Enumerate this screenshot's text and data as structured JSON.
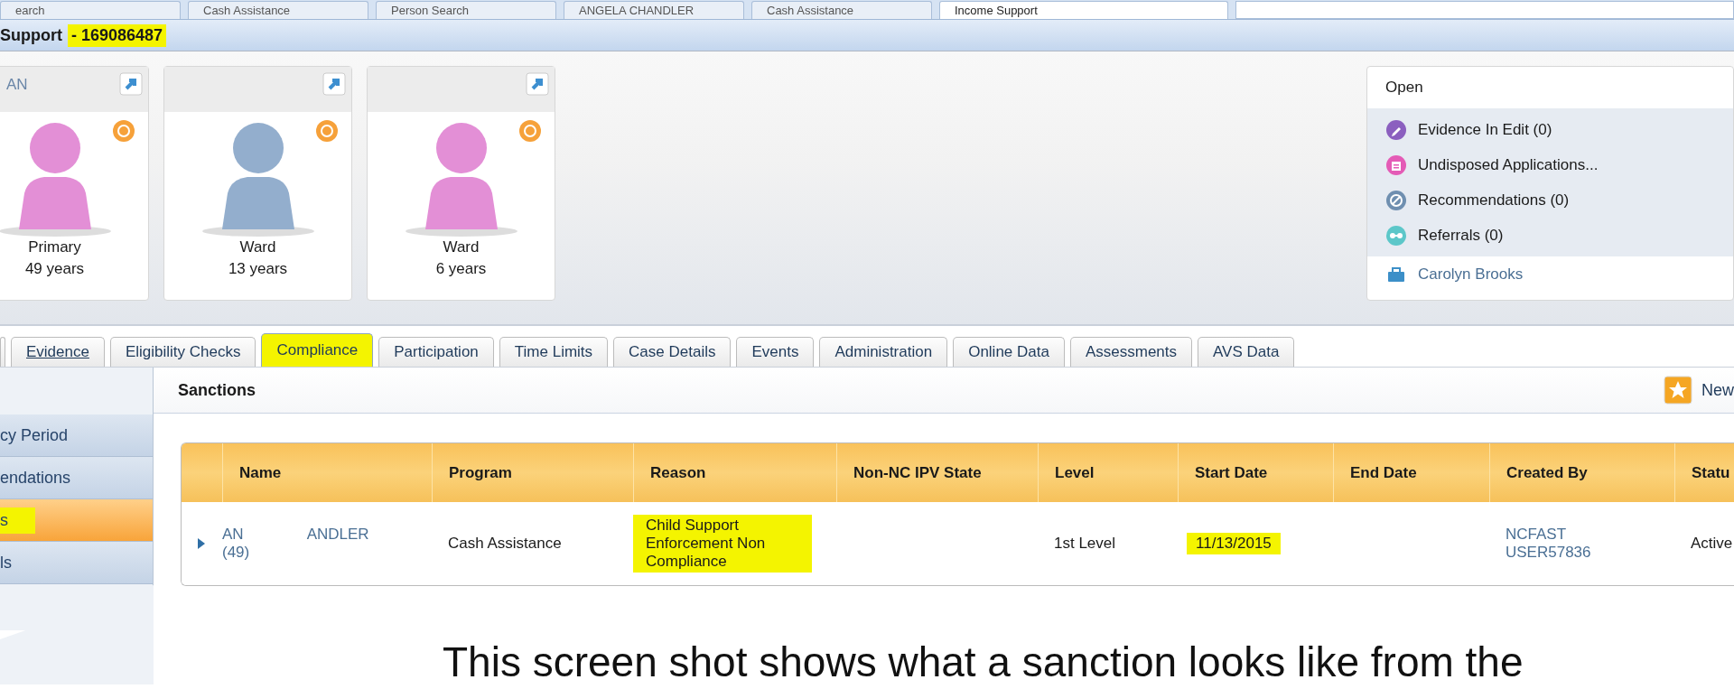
{
  "window_tabs": [
    {
      "label": "earch",
      "selected": false
    },
    {
      "label": "Cash Assistance",
      "selected": false
    },
    {
      "label": "Person Search",
      "selected": false
    },
    {
      "label": "ANGELA CHANDLER",
      "selected": false
    },
    {
      "label": "Cash Assistance",
      "selected": false
    },
    {
      "label": "Income Support",
      "selected": true
    }
  ],
  "title": {
    "text": "Support",
    "number": "- 169086487",
    "highlighted": true
  },
  "people": [
    {
      "name": "AN",
      "role": "Primary",
      "age": "49 years",
      "color": "#e38fd6"
    },
    {
      "role": "Ward",
      "age": "13 years",
      "color": "#93aecd"
    },
    {
      "role": "Ward",
      "age": "6 years",
      "color": "#e38fd6"
    }
  ],
  "open_panel": {
    "title": "Open",
    "items": [
      {
        "label": "Evidence In Edit (0)",
        "kind": "edit"
      },
      {
        "label": "Undisposed Applications...",
        "kind": "application"
      },
      {
        "label": "Recommendations (0)",
        "kind": "recommendation"
      },
      {
        "label": "Referrals (0)",
        "kind": "referral"
      }
    ],
    "owner": "Carolyn Brooks"
  },
  "case_tabs": [
    {
      "label": "Evidence",
      "selected": false,
      "kind": "link",
      "highlighted": false
    },
    {
      "label": "Eligibility Checks",
      "selected": false,
      "kind": "tab",
      "highlighted": false
    },
    {
      "label": "Compliance",
      "selected": true,
      "kind": "tab",
      "highlighted": true
    },
    {
      "label": "Participation",
      "selected": false,
      "kind": "tab",
      "highlighted": false
    },
    {
      "label": "Time Limits",
      "selected": false,
      "kind": "tab",
      "highlighted": false
    },
    {
      "label": "Case Details",
      "selected": false,
      "kind": "tab",
      "highlighted": false
    },
    {
      "label": "Events",
      "selected": false,
      "kind": "tab",
      "highlighted": false
    },
    {
      "label": "Administration",
      "selected": false,
      "kind": "tab",
      "highlighted": false
    },
    {
      "label": "Online Data",
      "selected": false,
      "kind": "tab",
      "highlighted": false
    },
    {
      "label": "Assessments",
      "selected": false,
      "kind": "tab",
      "highlighted": false
    },
    {
      "label": "AVS Data",
      "selected": false,
      "kind": "tab",
      "highlighted": false
    }
  ],
  "nav": [
    {
      "label": "cy Period",
      "selected": false,
      "highlighted": false
    },
    {
      "label": "endations",
      "selected": false,
      "highlighted": false
    },
    {
      "label": "s",
      "selected": true,
      "highlighted": true
    },
    {
      "label": "ls",
      "selected": false,
      "highlighted": false
    }
  ],
  "section": {
    "title": "Sanctions",
    "new_button": "New"
  },
  "table": {
    "columns": [
      "Name",
      "Program",
      "Reason",
      "Non-NC IPV State",
      "Level",
      "Start Date",
      "End Date",
      "Created By",
      "Statu"
    ],
    "rows": [
      {
        "expanded": false,
        "name_start": "AN",
        "name_end": "ANDLER",
        "age": "(49)",
        "program": "Cash Assistance",
        "reason": "Child Support Enforcement Non Compliance",
        "reason_highlighted": true,
        "level": "1st Level",
        "start_date": "11/13/2015",
        "start_date_highlighted": true,
        "created_by": "NCFAST USER57836",
        "status": "Active"
      }
    ]
  },
  "caption": "This screen shot shows what a sanction looks like from the"
}
